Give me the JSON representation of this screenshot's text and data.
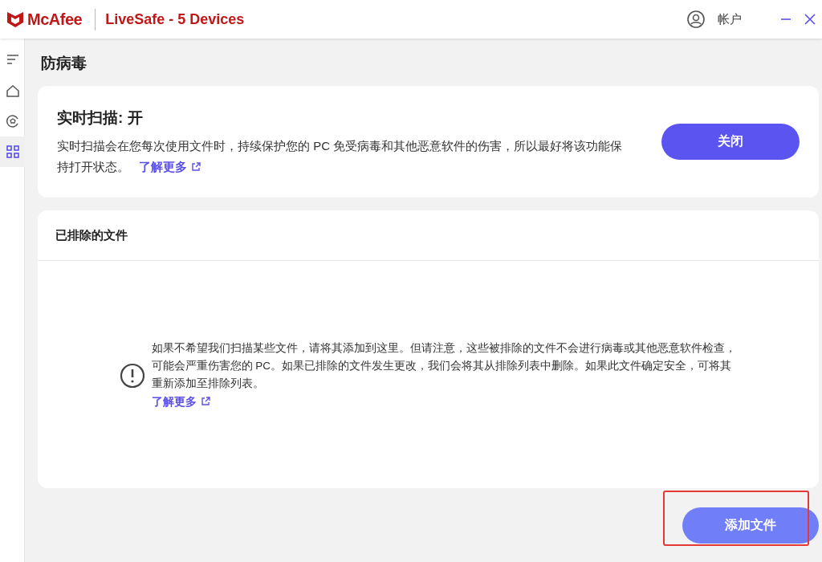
{
  "header": {
    "brand": "McAfee",
    "product": "LiveSafe - 5 Devices",
    "account": "帐户"
  },
  "sidebar": {
    "items": [
      {
        "kind": "menu",
        "selected": false
      },
      {
        "kind": "home",
        "selected": false
      },
      {
        "kind": "shield",
        "selected": false
      },
      {
        "kind": "apps",
        "selected": true
      }
    ]
  },
  "page_title": "防病毒",
  "realtime_card": {
    "title": "实时扫描: 开",
    "description": "实时扫描会在您每次使用文件时，持续保护您的 PC 免受病毒和其他恶意软件的伤害，所以最好将该功能保持打开状态。",
    "link": "了解更多",
    "button": "关闭"
  },
  "excluded_card": {
    "title": "已排除的文件",
    "notice": "如果不希望我们扫描某些文件，请将其添加到这里。但请注意，这些被排除的文件不会进行病毒或其他恶意软件检查，可能会严重伤害您的 PC。如果已排除的文件发生更改，我们会将其从排除列表中删除。如果此文件确定安全，可将其重新添加至排除列表。",
    "link": "了解更多"
  },
  "add_button": "添加文件"
}
